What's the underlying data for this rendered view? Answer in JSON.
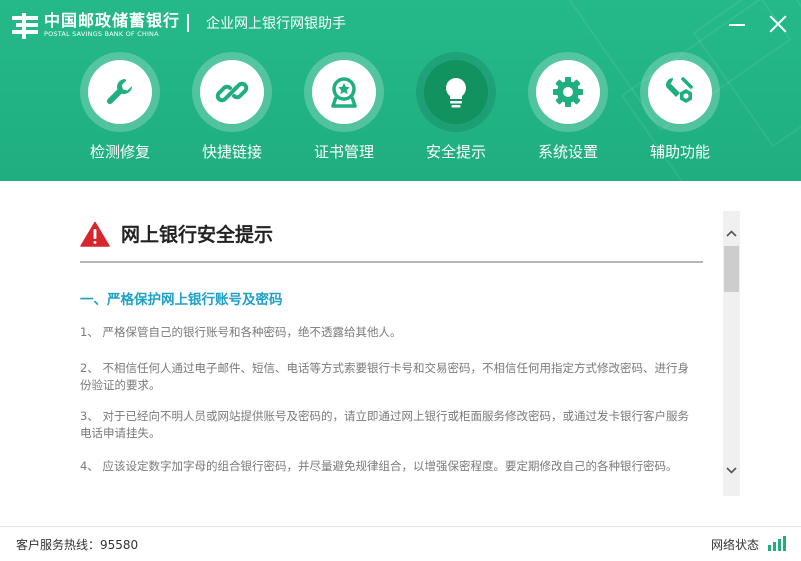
{
  "header": {
    "logo_cn": "中国邮政储蓄银行",
    "logo_en": "POSTAL SAVINGS BANK OF CHINA",
    "app_title": "企业网上银行网银助手"
  },
  "nav": [
    {
      "label": "检测修复",
      "icon": "wrench-icon",
      "active": false
    },
    {
      "label": "快捷链接",
      "icon": "link-icon",
      "active": false
    },
    {
      "label": "证书管理",
      "icon": "certificate-icon",
      "active": false
    },
    {
      "label": "安全提示",
      "icon": "lightbulb-icon",
      "active": true
    },
    {
      "label": "系统设置",
      "icon": "gear-icon",
      "active": false
    },
    {
      "label": "辅助功能",
      "icon": "tools-icon",
      "active": false
    }
  ],
  "content": {
    "title": "网上银行安全提示",
    "section_title": "一、严格保护网上银行账号及密码",
    "items": [
      "1、  严格保管自己的银行账号和各种密码，绝不透露给其他人。",
      "2、  不相信任何人通过电子邮件、短信、电话等方式索要银行卡号和交易密码，不相信任何用指定方式修改密码、进行身份验证的要求。",
      "3、  对于已经向不明人员或网站提供账号及密码的，请立即通过网上银行或柜面服务修改密码，或通过发卡银行客户服务电话申请挂失。",
      "4、  应该设定数字加字母的组合银行密码，并尽量避免规律组合，以增强保密程度。要定期修改自己的各种银行密码。"
    ]
  },
  "footer": {
    "hotline": "客户服务热线：95580",
    "network_label": "网络状态"
  },
  "colors": {
    "brand_green": "#1fae7f",
    "active_green": "#12925f",
    "section_blue": "#1ea0c8",
    "warning_red": "#d9262c"
  }
}
